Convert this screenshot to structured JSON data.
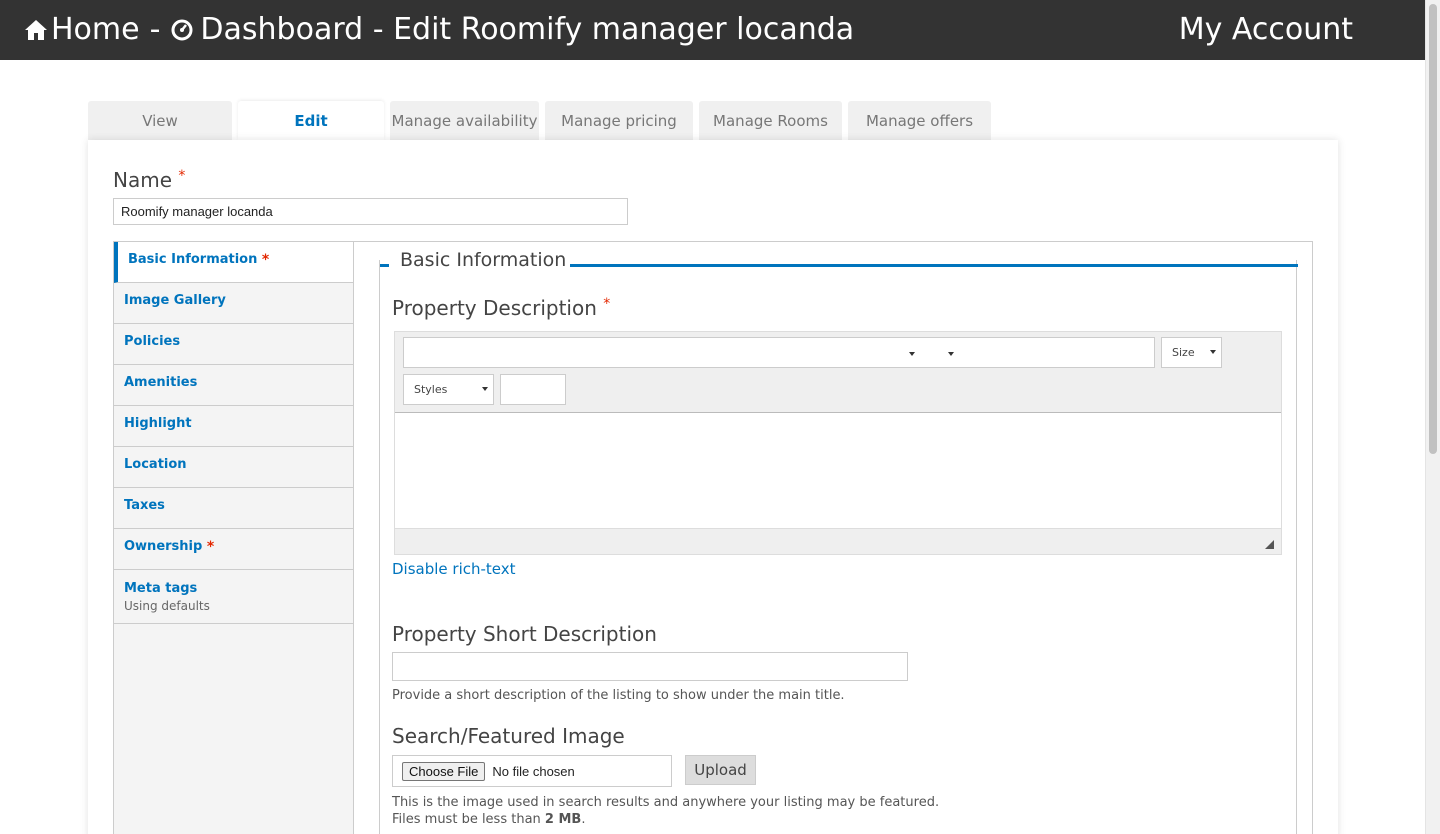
{
  "header": {
    "home_label": "Home",
    "separator": "-",
    "dashboard_label": "Dashboard - Edit Roomify manager locanda",
    "account_label": "My Account",
    "home_icon": "home-icon",
    "dashboard_icon": "dashboard-gauge-icon"
  },
  "tabs": [
    {
      "label": "View"
    },
    {
      "label": "Edit"
    },
    {
      "label": "Manage availability"
    },
    {
      "label": "Manage pricing"
    },
    {
      "label": "Manage Rooms"
    },
    {
      "label": "Manage offers"
    }
  ],
  "form": {
    "name_label": "Name",
    "required_mark": "*",
    "name_value": "Roomify manager locanda"
  },
  "vertical_tabs": [
    {
      "label": "Basic Information",
      "required": "*"
    },
    {
      "label": "Image Gallery"
    },
    {
      "label": "Policies"
    },
    {
      "label": "Amenities"
    },
    {
      "label": "Highlight"
    },
    {
      "label": "Location"
    },
    {
      "label": "Taxes"
    },
    {
      "label": "Ownership",
      "required": "*"
    },
    {
      "label": "Meta tags",
      "summary": "Using defaults"
    }
  ],
  "basic_info": {
    "legend": "Basic Information",
    "property_description_label": "Property Description",
    "toolbar": {
      "size_label": "Size",
      "styles_label": "Styles"
    },
    "disable_richtext": "Disable rich-text",
    "short_description_label": "Property Short Description",
    "short_description_help": "Provide a short description of the listing to show under the main title.",
    "featured_image_label": "Search/Featured Image",
    "choose_file_label": "Choose File",
    "no_file_label": "No file chosen",
    "upload_label": "Upload",
    "image_help_1": "This is the image used in search results and anywhere your listing may be featured.",
    "image_help_2_prefix": "Files must be less than ",
    "image_help_2_size": "2 MB",
    "image_help_2_suffix": "."
  },
  "colors": {
    "topbar": "#333333",
    "accent": "#0074bd",
    "required": "#e32700"
  }
}
